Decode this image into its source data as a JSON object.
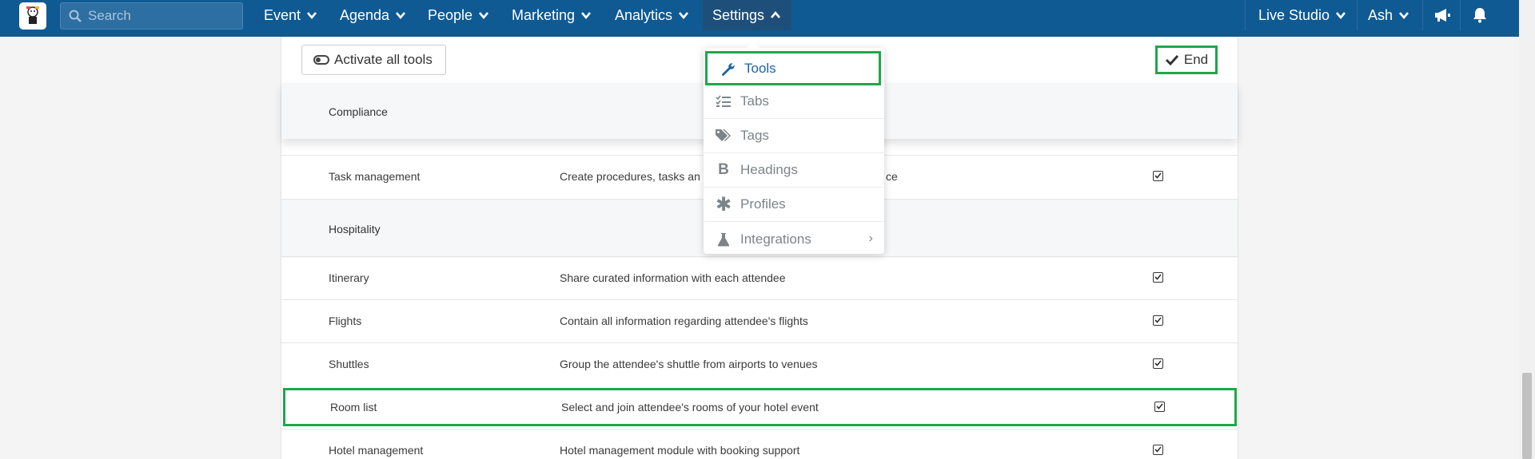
{
  "nav": {
    "search_placeholder": "Search",
    "items": [
      {
        "label": "Event"
      },
      {
        "label": "Agenda"
      },
      {
        "label": "People"
      },
      {
        "label": "Marketing"
      },
      {
        "label": "Analytics"
      },
      {
        "label": "Settings"
      }
    ],
    "right": [
      {
        "label": "Live Studio"
      },
      {
        "label": "Ash"
      }
    ],
    "icons": [
      "megaphone-icon",
      "bell-icon"
    ]
  },
  "toolbar": {
    "activate_label": "Activate all tools",
    "end_label": "End"
  },
  "dropdown": {
    "items": [
      {
        "label": "Tools",
        "icon": "wrench-icon"
      },
      {
        "label": "Tabs",
        "icon": "list-check-icon"
      },
      {
        "label": "Tags",
        "icon": "tags-icon"
      },
      {
        "label": "Headings",
        "icon": "bold-icon"
      },
      {
        "label": "Profiles",
        "icon": "asterisk-icon"
      },
      {
        "label": "Integrations",
        "icon": "flask-icon",
        "arrow": "›"
      }
    ]
  },
  "sections": [
    {
      "title": "Compliance"
    },
    {
      "title": "Hospitality"
    }
  ],
  "rows": [
    {
      "name": "Task management",
      "desc": "Create procedures, tasks an",
      "desc_tail": "ce"
    },
    {
      "name": "Itinerary",
      "desc": "Share curated information with each attendee"
    },
    {
      "name": "Flights",
      "desc": "Contain all information regarding attendee's flights"
    },
    {
      "name": "Shuttles",
      "desc": "Group the attendee's shuttle from airports to venues"
    },
    {
      "name": "Room list",
      "desc": "Select and join attendee's rooms of your hotel event"
    },
    {
      "name": "Hotel management",
      "desc": "Hotel management module with booking support"
    }
  ]
}
